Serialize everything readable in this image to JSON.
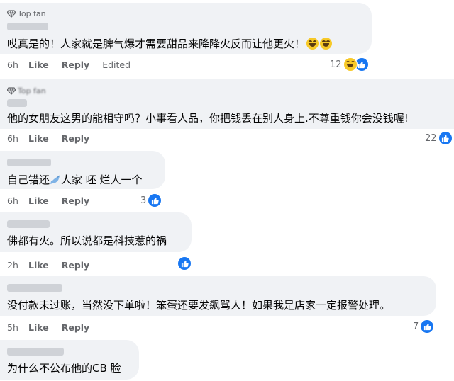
{
  "comments": [
    {
      "badge": "Top fan",
      "text": "哎真是的！人家就是脾气爆才需要甜品来降降火反而让他更火！",
      "emojis": [
        "haha-emoji",
        "haha-emoji"
      ],
      "time": "6h",
      "like": "Like",
      "reply": "Reply",
      "edited": "Edited",
      "reaction_count": "12",
      "reaction_icons": [
        "haha-icon",
        "like-icon"
      ]
    },
    {
      "badge": "Top fan",
      "text": "他的女朋友这男的能相守吗？小事看人品，你把钱丢在别人身上.不尊重钱你会没钱喔!",
      "time": "6h",
      "like": "Like",
      "reply": "Reply",
      "reaction_count": "22",
      "reaction_icons": [
        "like-icon"
      ]
    },
    {
      "text_before": "自己错还",
      "text_after": "人家 呸 烂人一个",
      "inline_icon": "bird-icon",
      "time": "6h",
      "like": "Like",
      "reply": "Reply",
      "reaction_count": "3",
      "reaction_icons": [
        "like-icon"
      ]
    },
    {
      "text": "佛都有火。所以说都是科技惹的祸",
      "time": "2h",
      "like": "Like",
      "reply": "Reply",
      "reaction_count": "",
      "reaction_icons": [
        "like-icon"
      ]
    },
    {
      "text": "没付款未过账，当然没下单啦！笨蛋还要发飙骂人！如果我是店家一定报警处理。",
      "time": "5h",
      "like": "Like",
      "reply": "Reply",
      "reaction_count": "7",
      "reaction_icons": [
        "like-icon"
      ]
    },
    {
      "text": "为什么不公布他的CB 脸"
    }
  ],
  "colors": {
    "bubble": "#f0f2f5",
    "like_blue": "#1877f2",
    "haha_yellow": "#f7c928",
    "meta_gray": "#65676b"
  }
}
